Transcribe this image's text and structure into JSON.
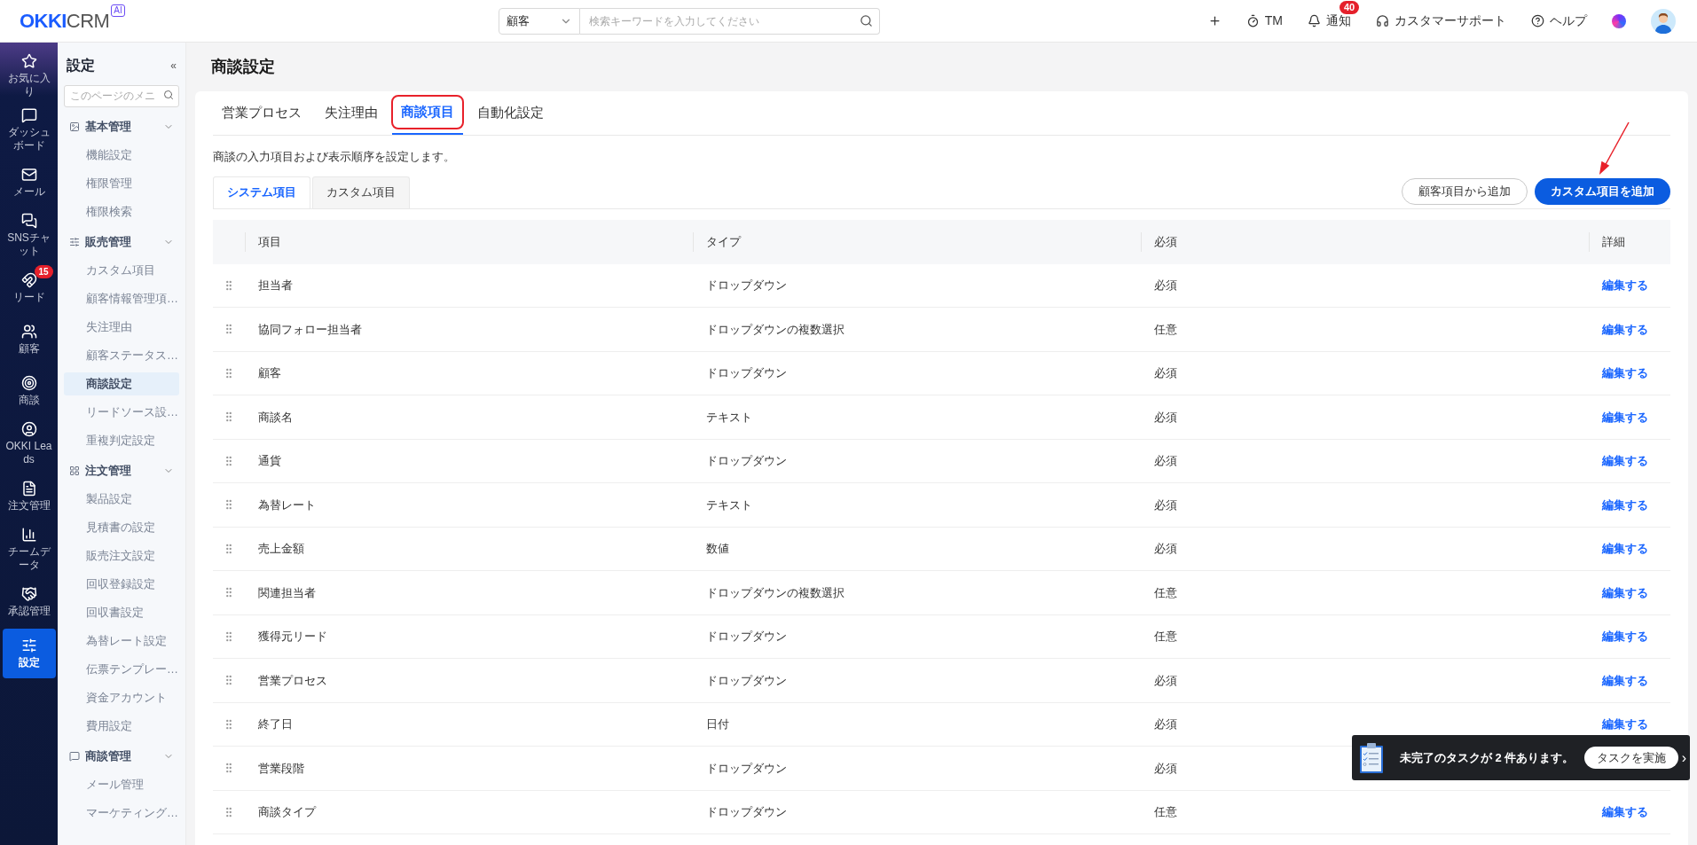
{
  "header": {
    "logo_main": "OKKI",
    "logo_sub": "CRM",
    "logo_badge": "AI",
    "search_scope": "顧客",
    "search_placeholder": "検索キーワードを入力してください",
    "actions": [
      {
        "kind": "plus"
      },
      {
        "kind": "timer",
        "label": "TM"
      },
      {
        "kind": "bell",
        "label": "通知",
        "badge": "40"
      },
      {
        "kind": "headset",
        "label": "カスタマーサポート"
      },
      {
        "kind": "help",
        "label": "ヘルプ"
      },
      {
        "kind": "orb"
      },
      {
        "kind": "avatar"
      }
    ]
  },
  "nav": [
    {
      "kind": "star",
      "label": "お気に入り",
      "selected": false
    },
    {
      "kind": "dashboard",
      "label": "ダッシュボード",
      "selected": false
    },
    {
      "kind": "mail",
      "label": "メール",
      "selected": false
    },
    {
      "kind": "chat",
      "label": "SNSチャット",
      "selected": false
    },
    {
      "kind": "leads",
      "label": "リード",
      "badge": "15",
      "selected": false
    },
    {
      "kind": "people",
      "label": "顧客",
      "selected": false
    },
    {
      "kind": "target",
      "label": "商談",
      "selected": false
    },
    {
      "kind": "person",
      "label": "OKKI Leads",
      "selected": false
    },
    {
      "kind": "doc",
      "label": "注文管理",
      "selected": false
    },
    {
      "kind": "bars",
      "label": "チームデータ",
      "selected": false
    },
    {
      "kind": "handshake",
      "label": "承認管理",
      "selected": false
    },
    {
      "kind": "sliders",
      "label": "設定",
      "selected": true
    }
  ],
  "settings_menu": {
    "title": "設定",
    "collapse": "«",
    "search_placeholder": "このページのメニ",
    "groups": [
      {
        "kind": "image",
        "label": "基本管理",
        "expanded": true,
        "children": [
          {
            "label": "機能設定",
            "selected": false
          },
          {
            "label": "権限管理",
            "selected": false
          },
          {
            "label": "権限検索",
            "selected": false
          }
        ]
      },
      {
        "kind": "sliders",
        "label": "販売管理",
        "expanded": true,
        "children": [
          {
            "label": "カスタム項目",
            "selected": false
          },
          {
            "label": "顧客情報管理項…",
            "selected": false
          },
          {
            "label": "失注理由",
            "selected": false
          },
          {
            "label": "顧客ステータス…",
            "selected": false
          },
          {
            "label": "商談設定",
            "selected": true
          },
          {
            "label": "リードソース設…",
            "selected": false
          },
          {
            "label": "重複判定設定",
            "selected": false
          }
        ]
      },
      {
        "kind": "grid",
        "label": "注文管理",
        "expanded": true,
        "children": [
          {
            "label": "製品設定",
            "selected": false
          },
          {
            "label": "見積書の設定",
            "selected": false
          },
          {
            "label": "販売注文設定",
            "selected": false
          },
          {
            "label": "回収登録設定",
            "selected": false
          },
          {
            "label": "回収書設定",
            "selected": false
          },
          {
            "label": "為替レート設定",
            "selected": false
          },
          {
            "label": "伝票テンプレー…",
            "selected": false
          },
          {
            "label": "資金アカウント",
            "selected": false
          },
          {
            "label": "費用設定",
            "selected": false
          }
        ]
      },
      {
        "kind": "chat",
        "label": "商談管理",
        "expanded": true,
        "children": [
          {
            "label": "メール管理",
            "selected": false
          },
          {
            "label": "マーケティング…",
            "selected": false
          }
        ]
      }
    ]
  },
  "page_title": "商談設定",
  "tabs": [
    {
      "label": "営業プロセス",
      "selected": false,
      "highlighted": false
    },
    {
      "label": "失注理由",
      "selected": false,
      "highlighted": false
    },
    {
      "label": "商談項目",
      "selected": true,
      "highlighted": true
    },
    {
      "label": "自動化設定",
      "selected": false,
      "highlighted": false
    }
  ],
  "description": "商談の入力項目および表示順序を設定します。",
  "subtabs": [
    {
      "label": "システム項目",
      "selected": true
    },
    {
      "label": "カスタム項目",
      "selected": false
    }
  ],
  "buttons": [
    {
      "label": "顧客項目から追加",
      "kind": "outline",
      "pointed_at": false
    },
    {
      "label": "カスタム項目を追加",
      "kind": "primary",
      "pointed_at": true
    }
  ],
  "table": {
    "columns": [
      "項目",
      "タイプ",
      "必須",
      "詳細"
    ],
    "rows": [
      {
        "name": "担当者",
        "type": "ドロップダウン",
        "required": "必須",
        "action": "編集する"
      },
      {
        "name": "協同フォロー担当者",
        "type": "ドロップダウンの複数選択",
        "required": "任意",
        "action": "編集する"
      },
      {
        "name": "顧客",
        "type": "ドロップダウン",
        "required": "必須",
        "action": "編集する"
      },
      {
        "name": "商談名",
        "type": "テキスト",
        "required": "必須",
        "action": "編集する"
      },
      {
        "name": "通貨",
        "type": "ドロップダウン",
        "required": "必須",
        "action": "編集する"
      },
      {
        "name": "為替レート",
        "type": "テキスト",
        "required": "必須",
        "action": "編集する"
      },
      {
        "name": "売上金額",
        "type": "数値",
        "required": "必須",
        "action": "編集する"
      },
      {
        "name": "関連担当者",
        "type": "ドロップダウンの複数選択",
        "required": "任意",
        "action": "編集する"
      },
      {
        "name": "獲得元リード",
        "type": "ドロップダウン",
        "required": "任意",
        "action": "編集する"
      },
      {
        "name": "営業プロセス",
        "type": "ドロップダウン",
        "required": "必須",
        "action": "編集する"
      },
      {
        "name": "終了日",
        "type": "日付",
        "required": "必須",
        "action": "編集する"
      },
      {
        "name": "営業段階",
        "type": "ドロップダウン",
        "required": "必須"
      },
      {
        "name": "商談タイプ",
        "type": "ドロップダウン",
        "required": "任意",
        "action": "編集する"
      }
    ]
  },
  "task_popup": {
    "message": "未完了のタスクが 2 件あります。",
    "button": "タスクを実施",
    "more": "›"
  }
}
